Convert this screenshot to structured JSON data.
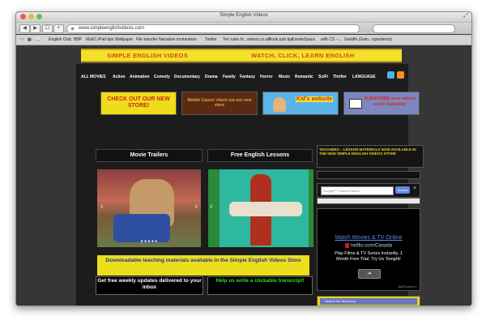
{
  "window": {
    "title": "Simple English Videos",
    "colors": {
      "close": "#e65c4f",
      "minimize": "#e7b93c",
      "zoom": "#67c04e"
    }
  },
  "toolbar": {
    "url": "www.simpleenglishvideos.com"
  },
  "bookmarks": [
    "English Club",
    "BBP",
    "MyEC",
    "iPad tips",
    "Wallpaper",
    "File transfer",
    "Narrative momentum",
    "Twitter",
    "Ten rules fo...writers.co.uk",
    "Book pub tips",
    "CreateSpace",
    "with CS – ...",
    "Getaffe (Goin...ngredients)"
  ],
  "page": {
    "banner_left": "SIMPLE ENGLISH VIDEOS",
    "banner_right": "WATCH, CLICK, LEARN ENGLISH",
    "menu": [
      "ALL MOVIES",
      "Action",
      "Animation",
      "Comedy",
      "Documentary",
      "Drama",
      "Family",
      "Fantasy",
      "Horror",
      "Music",
      "Romantic",
      "SciFi",
      "Thriller",
      "LANGUAGE"
    ],
    "store_buttons": [
      "CHECK OUT OUR NEW STORE!",
      "Mobile Cases! check out our new store",
      "Kid's website",
      "SUBSCRIBE new videos every Saturday"
    ],
    "teachers_notice": "TEACHERS – LESSON MATERIALS NOW AVAILABLE IN THE NEW SIMPLE ENGLISH VIDEOS STORE",
    "movie_trailers": "Movie Trailers",
    "free_lessons": "Free English Lessons",
    "search_placeholder": "Google™ Custom Search",
    "search_button": "Search",
    "search_close": "×",
    "teaching_materials": "Downloadable teaching materials available in the Simple English Videos Store",
    "weekly_updates": "Get free weekly updates delivered to your inbox",
    "help_transcript": "Help us write a clickable transcript!",
    "ad": {
      "title": "Watch Movies & TV Online",
      "url": "netflix.com/Canada",
      "body": "Play Films & TV Series Instantly. 1 Month Free Trial. Try Us Tonight!",
      "choices": "AdChoices ▷",
      "go": "➔"
    },
    "dictionary": "Search the Dictionary"
  }
}
